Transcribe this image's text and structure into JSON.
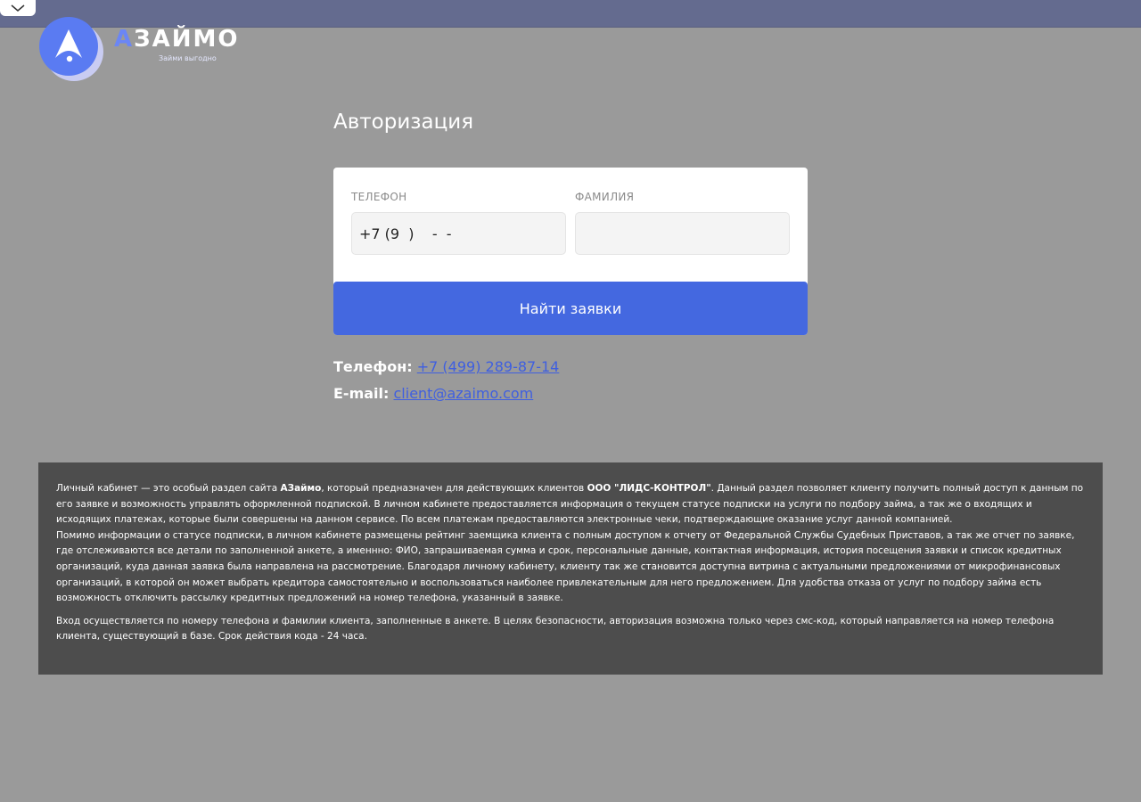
{
  "logo": {
    "brand_accent": "А",
    "brand_rest": "ЗАЙМО",
    "tagline": "Займи выгодно",
    "icon": "rocket-icon"
  },
  "auth": {
    "title": "Авторизация",
    "phone_label": "Телефон",
    "phone_value": "+7 (9  )    -  -",
    "surname_label": "Фамилия",
    "surname_value": "",
    "submit_label": "Найти заявки"
  },
  "contacts": {
    "phone_label": "Телефон:",
    "phone_value": "+7 (499) 289-87-14",
    "email_label": "E-mail:",
    "email_value": "client@azaimo.com"
  },
  "info": {
    "p1_a": "Личный кабинет — это особый раздел сайта ",
    "p1_brand": "АЗаймо",
    "p1_b": ", который предназначен для действующих клиентов ",
    "p1_company": "ООО \"ЛИДС-КОНТРОЛ\"",
    "p1_c": ". Данный раздел позволяет клиенту получить полный доступ к данным по его заявке и возможность управлять оформленной подпиской. В личном кабинете предоставляется информация о текущем статусе подписки на услуги по подбору займа, а так же о входящих и исходящих платежах, которые были совершены на данном сервисе. По всем платежам предоставляются электронные чеки, подтверждающие оказание услуг данной компанией.",
    "p1_d": "Помимо информации о статусе подписки, в личном кабинете размещены рейтинг заемщика клиента с полным доступом к отчету от Федеральной Службы Судебных Приставов, а так же отчет по заявке, где отслеживаются все детали по заполненной анкете, а именнно: ФИО, запрашиваемая сумма и срок, персональные данные, контактная информация, история посещения заявки и список кредитных организаций, куда данная заявка была направлена на рассмотрение. Благодаря личному кабинету, клиенту так же становится доступна витрина с актуальными предложениями от микрофинансовых организаций, в которой он может выбрать кредитора самостоятельно и воспользоваться наиболее привлекательным для него предложением. Для удобства отказа от услуг по подбору займа есть возможность отключить рассылку кредитных предложений на номер телефона, указанный в заявке.",
    "p2": "Вход осуществляется по номеру телефона и фамилии клиента, заполненные в анкете. В целях безопасности, авторизация возможна только через смс-код, который направляется на номер телефона клиента, существующий в базе. Срок действия кода - 24 часа."
  },
  "colors": {
    "background": "#9a9a9a",
    "top_bar": "#646b8f",
    "accent": "#4468e0",
    "info_box": "#4d4d4d"
  }
}
